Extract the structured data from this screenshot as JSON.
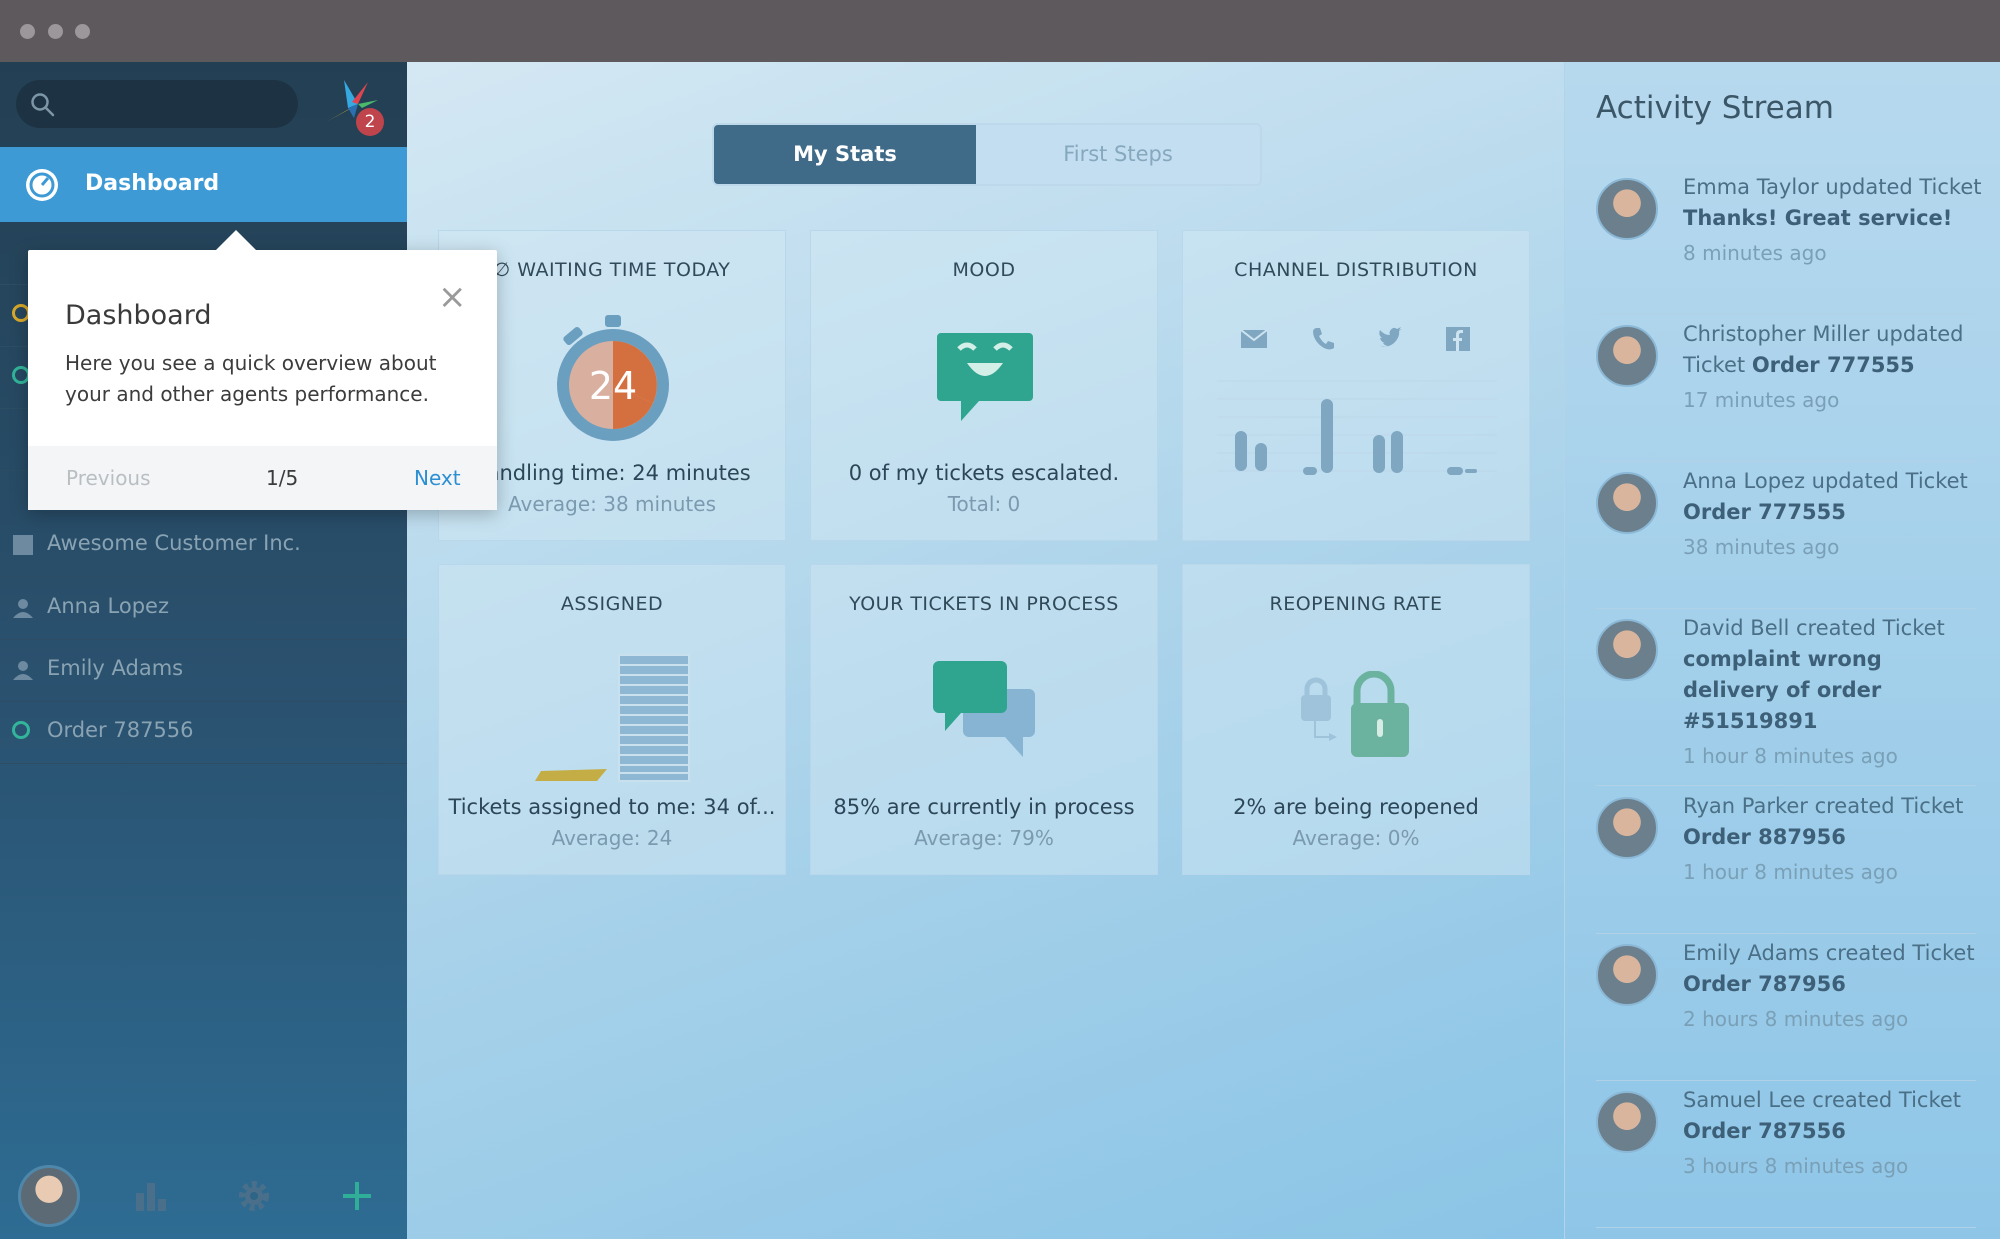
{
  "sidebar": {
    "search_placeholder": "",
    "badge_count": "2",
    "active_item": "Dashboard",
    "items": [
      {
        "label": "Awesome Customer Inc.",
        "icon": "building-icon"
      },
      {
        "label": "Anna Lopez",
        "icon": "user-icon"
      },
      {
        "label": "Emily Adams",
        "icon": "user-icon"
      },
      {
        "label": "Order 787556",
        "icon": "open-ticket-icon"
      }
    ]
  },
  "popover": {
    "title": "Dashboard",
    "text": "Here you see a quick overview about your and other agents performance.",
    "previous": "Previous",
    "counter": "1/5",
    "next": "Next"
  },
  "tabs": {
    "active": "My Stats",
    "inactive": "First Steps"
  },
  "cards": [
    {
      "title": "∅ WAITING TIME TODAY",
      "main": "handling time: 24 minutes",
      "sub": "Average: 38 minutes",
      "icon_value": "24"
    },
    {
      "title": "MOOD",
      "main": "0 of my tickets escalated.",
      "sub": "Total: 0"
    },
    {
      "title": "CHANNEL DISTRIBUTION",
      "main": "",
      "sub": ""
    },
    {
      "title": "ASSIGNED",
      "main": "Tickets assigned to me: 34 of...",
      "sub": "Average: 24"
    },
    {
      "title": "YOUR TICKETS IN PROCESS",
      "main": "85% are currently in process",
      "sub": "Average: 79%"
    },
    {
      "title": "REOPENING RATE",
      "main": "2% are being reopened",
      "sub": "Average: 0%"
    }
  ],
  "stream": {
    "title": "Activity Stream",
    "items": [
      {
        "actor": "Emma Taylor updated Ticket",
        "object": "Thanks! Great service!",
        "time": "8 minutes ago"
      },
      {
        "actor": "Christopher Miller updated Ticket",
        "object": "Order 777555",
        "time": "17 minutes ago"
      },
      {
        "actor": "Anna Lopez updated Ticket",
        "object": "Order 777555",
        "time": "38 minutes ago"
      },
      {
        "actor": "David Bell created Ticket",
        "object": "complaint wrong delivery of order #51519891",
        "time": "1 hour 8 minutes ago"
      },
      {
        "actor": "Ryan Parker created Ticket",
        "object": "Order 887956",
        "time": "1 hour 8 minutes ago"
      },
      {
        "actor": "Emily Adams created Ticket",
        "object": "Order 787956",
        "time": "2 hours 8 minutes ago"
      },
      {
        "actor": "Samuel Lee created Ticket",
        "object": "Order 787556",
        "time": "3 hours 8 minutes ago"
      }
    ]
  },
  "colors": {
    "accent": "#3e9ad5",
    "sidebar": "#233f53",
    "mood": "#2fa58f"
  }
}
